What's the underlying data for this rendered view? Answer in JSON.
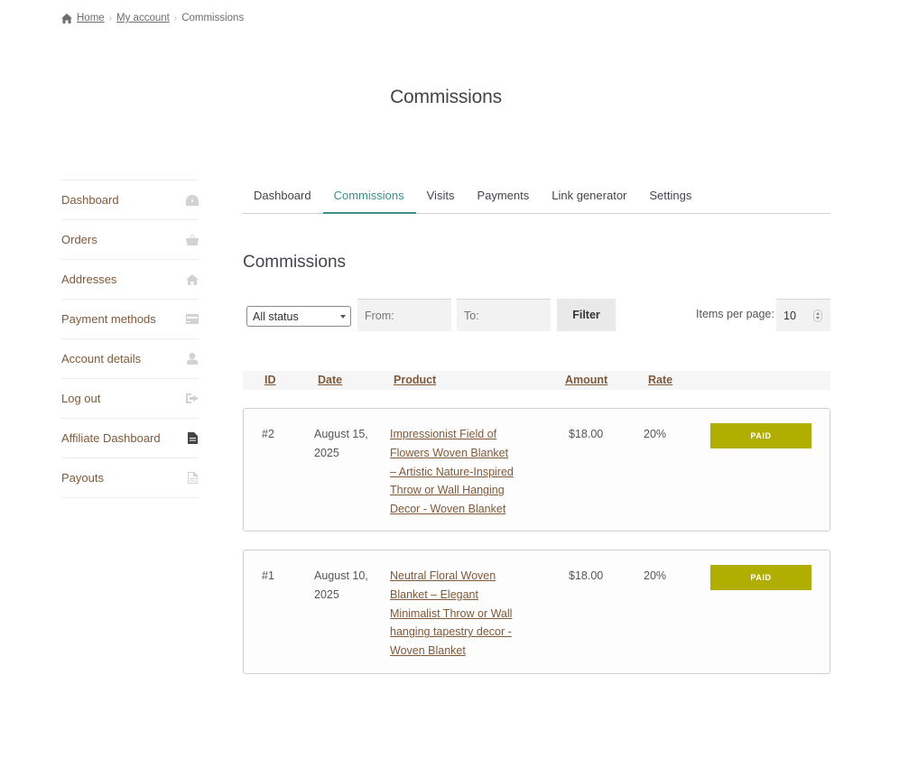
{
  "breadcrumb": {
    "home": "Home",
    "account": "My account",
    "current": "Commissions"
  },
  "page_title": "Commissions",
  "sidebar": {
    "items": [
      {
        "label": "Dashboard",
        "icon": "dashboard-icon"
      },
      {
        "label": "Orders",
        "icon": "basket-icon"
      },
      {
        "label": "Addresses",
        "icon": "home-icon"
      },
      {
        "label": "Payment methods",
        "icon": "credit-card-icon"
      },
      {
        "label": "Account details",
        "icon": "user-icon"
      },
      {
        "label": "Log out",
        "icon": "logout-icon"
      },
      {
        "label": "Affiliate Dashboard",
        "icon": "document-icon"
      },
      {
        "label": "Payouts",
        "icon": "document-outline-icon"
      }
    ]
  },
  "tabs": [
    "Dashboard",
    "Commissions",
    "Visits",
    "Payments",
    "Link generator",
    "Settings"
  ],
  "section_title": "Commissions",
  "filters": {
    "status_value": "All status",
    "from_placeholder": "From:",
    "to_placeholder": "To:",
    "filter_label": "Filter",
    "items_per_page_label": "Items per page:",
    "items_per_page_value": "10"
  },
  "table": {
    "headers": [
      "ID",
      "Date",
      "Product",
      "Amount",
      "Rate"
    ],
    "rows": [
      {
        "id": "#2",
        "date": "August 15, 2025",
        "product": "Impressionist Field of Flowers Woven Blanket – Artistic Nature-Inspired Throw or Wall Hanging Decor - Woven Blanket",
        "amount": "$18.00",
        "rate": "20%",
        "status": "PAID"
      },
      {
        "id": "#1",
        "date": "August 10, 2025",
        "product": "Neutral Floral Woven Blanket – Elegant Minimalist Throw or Wall hanging tapestry decor - Woven Blanket",
        "amount": "$18.00",
        "rate": "20%",
        "status": "PAID"
      }
    ]
  },
  "colors": {
    "accent": "#3d8f8a",
    "link": "#7f5a3a",
    "paid_badge": "#b0ae00"
  }
}
